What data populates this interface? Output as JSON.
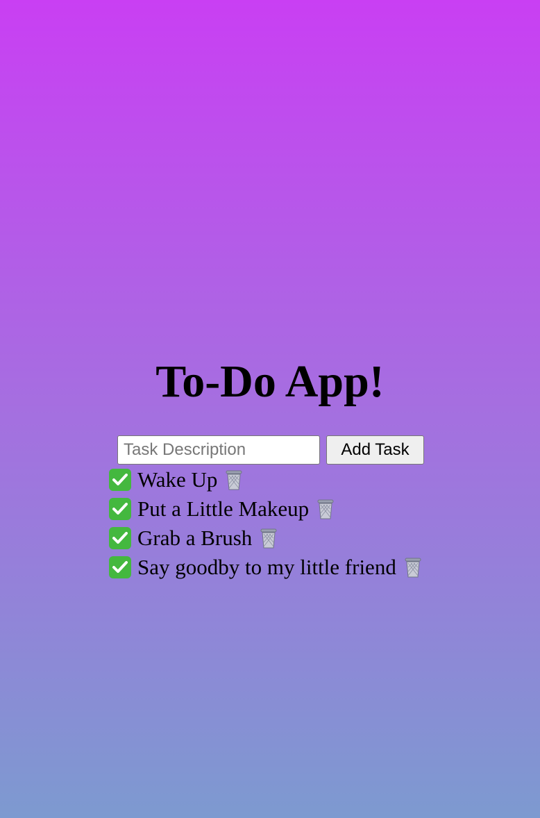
{
  "app": {
    "title": "To-Do App!"
  },
  "form": {
    "placeholder": "Task Description",
    "value": "",
    "add_label": "Add Task"
  },
  "tasks": [
    {
      "text": "Wake Up",
      "done": true
    },
    {
      "text": "Put a Little Makeup",
      "done": true
    },
    {
      "text": "Grab a Brush",
      "done": true
    },
    {
      "text": "Say goodby to my little friend",
      "done": true
    }
  ],
  "icons": {
    "complete": "check-icon",
    "delete": "trash-icon"
  },
  "colors": {
    "gradient_top": "#c93ff3",
    "gradient_bottom": "#7d9ad0",
    "check_green": "#44b83f"
  }
}
